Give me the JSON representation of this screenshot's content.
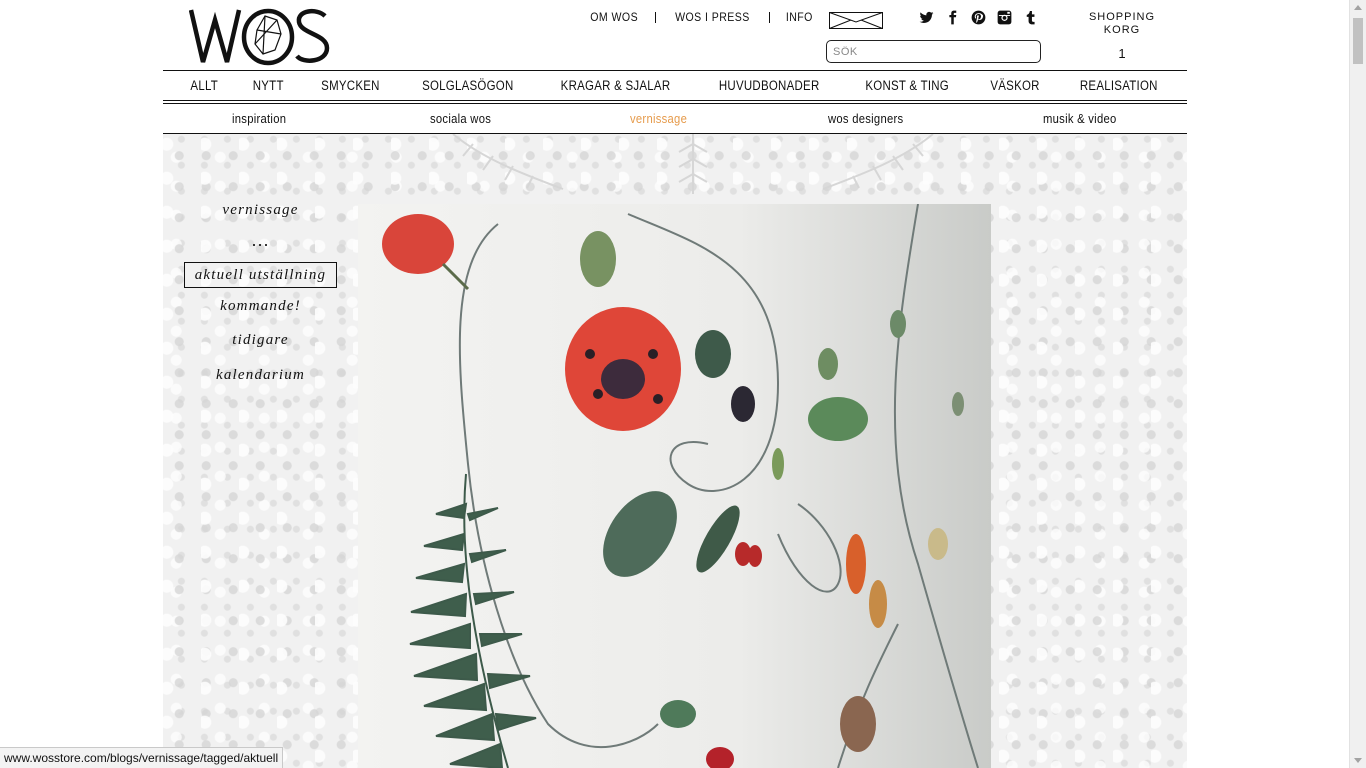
{
  "header": {
    "logo_text": "WOS",
    "top_links": [
      "OM WOS",
      "WOS I PRESS",
      "INFO"
    ],
    "search_placeholder": "SÖK",
    "cart": {
      "label_line1": "SHOPPING",
      "label_line2": "KORG",
      "count": "1"
    },
    "social_icons": [
      "twitter-icon",
      "facebook-icon",
      "pinterest-icon",
      "instagram-icon",
      "tumblr-icon"
    ]
  },
  "main_nav": [
    "ALLT",
    "NYTT",
    "SMYCKEN",
    "SOLGLASÖGON",
    "KRAGAR & SJALAR",
    "HUVUDBONADER",
    "KONST & TING",
    "VÄSKOR",
    "REALISATION"
  ],
  "sub_nav": {
    "items": [
      "inspiration",
      "sociala wos",
      "vernissage",
      "wos designers",
      "musik & video"
    ],
    "active": "vernissage"
  },
  "side_menu": {
    "heading": "vernissage",
    "dots": "...",
    "items": [
      "aktuell utställning",
      "kommande!",
      "tidigare",
      "kalendarium"
    ]
  },
  "status_bar": "www.wosstore.com/blogs/vernissage/tagged/aktuell",
  "colors": {
    "accent": "#e69b4c",
    "text": "#111111",
    "bg_texture": "#f1f1f1"
  }
}
